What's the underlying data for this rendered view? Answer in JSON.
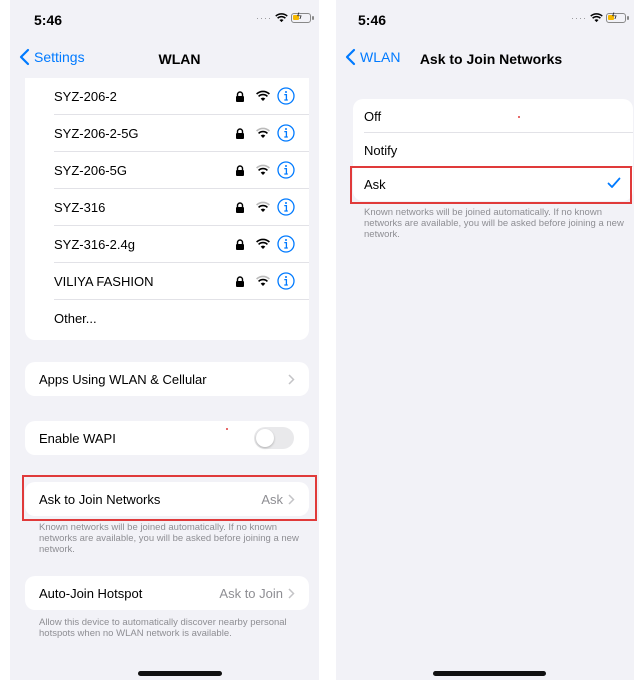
{
  "colors": {
    "accent": "#007aff",
    "secondary_text": "#8e8e93",
    "highlight": "#e03a3a"
  },
  "left": {
    "status_time": "5:46",
    "back_label": "Settings",
    "title": "WLAN",
    "networks": [
      {
        "name": "SYZ-206-2"
      },
      {
        "name": "SYZ-206-2-5G"
      },
      {
        "name": "SYZ-206-5G"
      },
      {
        "name": "SYZ-316"
      },
      {
        "name": "SYZ-316-2.4g"
      },
      {
        "name": "VILIYA FASHION"
      }
    ],
    "other_label": "Other...",
    "apps_label": "Apps Using WLAN & Cellular",
    "wapi_label": "Enable WAPI",
    "ask_label": "Ask to Join Networks",
    "ask_value": "Ask",
    "ask_footer": "Known networks will be joined automatically. If no known networks are available, you will be asked before joining a new network.",
    "hotspot_label": "Auto-Join Hotspot",
    "hotspot_value": "Ask to Join",
    "hotspot_footer": "Allow this device to automatically discover nearby personal hotspots when no WLAN network is available."
  },
  "right": {
    "status_time": "5:46",
    "back_label": "WLAN",
    "title": "Ask to Join Networks",
    "options": [
      {
        "label": "Off"
      },
      {
        "label": "Notify"
      },
      {
        "label": "Ask"
      }
    ],
    "selected": "Ask",
    "footer": "Known networks will be joined automatically. If no known networks are available, you will be asked before joining a new network."
  }
}
